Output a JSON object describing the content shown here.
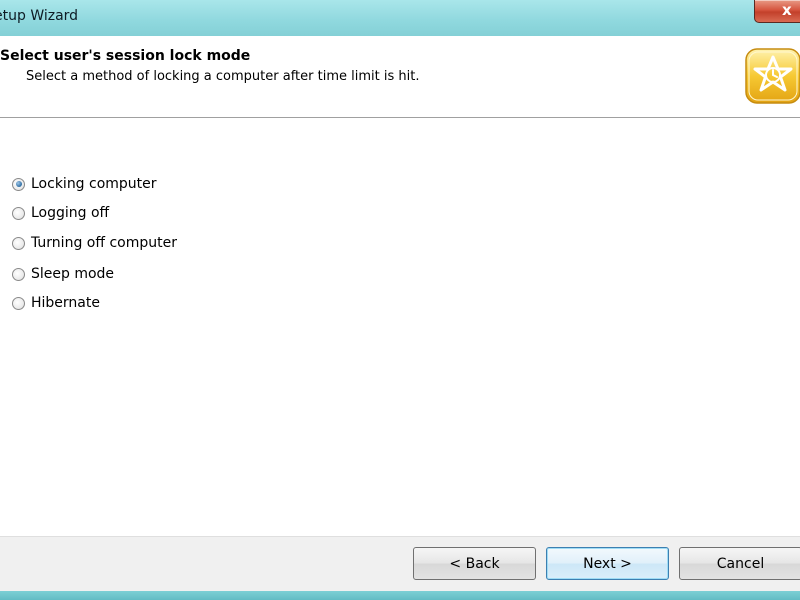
{
  "window": {
    "title": "etup Wizard",
    "close_label": "x"
  },
  "header": {
    "title": "Select user's session lock mode",
    "subtitle": "Select a method of locking a computer after time limit is hit.",
    "logo_icon": "star-badge-icon"
  },
  "options": [
    {
      "label": "Locking computer",
      "checked": true
    },
    {
      "label": "Logging off",
      "checked": false
    },
    {
      "label": "Turning off computer",
      "checked": false
    },
    {
      "label": "Sleep mode",
      "checked": false
    },
    {
      "label": "Hibernate",
      "checked": false
    }
  ],
  "buttons": {
    "back": "< Back",
    "next": "Next >",
    "cancel": "Cancel"
  },
  "colors": {
    "title_bar": "#8fd8de",
    "close_button": "#d6553f",
    "default_button_border": "#3c7fb1",
    "logo_gold": "#f2c12e"
  }
}
